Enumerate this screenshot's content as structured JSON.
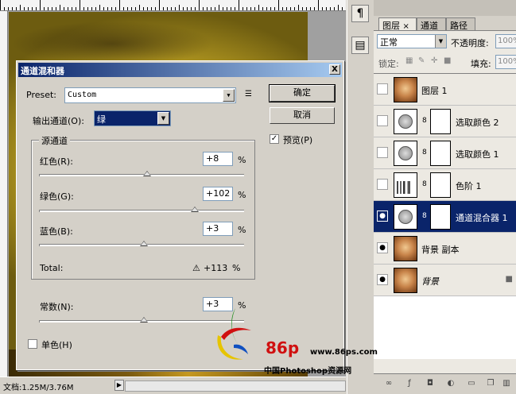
{
  "statusbar": {
    "doc_info": "文档:1.25M/3.76M",
    "arrow": "▶"
  },
  "tool_strip": {
    "pilcrow": "¶",
    "doc": "▤"
  },
  "layers_panel": {
    "tabs": [
      {
        "label": "图层",
        "close": "×"
      },
      {
        "label": "通道"
      },
      {
        "label": "路径"
      }
    ],
    "blend_mode": "正常",
    "opacity_label": "不透明度:",
    "opacity_value": "100%",
    "lock_label": "锁定:",
    "fill_label": "填充:",
    "fill_value": "100%",
    "layers": [
      {
        "name": "图层 1",
        "type": "photo",
        "visible": false
      },
      {
        "name": "选取颜色 2",
        "type": "selective-color",
        "visible": false
      },
      {
        "name": "选取颜色 1",
        "type": "selective-color",
        "visible": false
      },
      {
        "name": "色阶 1",
        "type": "levels",
        "visible": false
      },
      {
        "name": "通道混合器 1",
        "type": "channel-mixer",
        "visible": true,
        "selected": true
      },
      {
        "name": "背景 副本",
        "type": "photo",
        "visible": true
      },
      {
        "name": "背景",
        "type": "photo",
        "visible": true,
        "locked": true
      }
    ]
  },
  "dialog": {
    "title": "通道混和器",
    "close": "X",
    "preset_label": "Preset:",
    "preset_value": "Custom",
    "output_label": "输出通道(O):",
    "output_value": "绿",
    "ok_label": "确定",
    "cancel_label": "取消",
    "preview_label": "预览(P)",
    "preview_checked": true,
    "source_group_label": "源通道",
    "red_label": "红色(R):",
    "red_value": "+8",
    "green_label": "绿色(G):",
    "green_value": "+102",
    "blue_label": "蓝色(B):",
    "blue_value": "+3",
    "percent": "%",
    "total_label": "Total:",
    "total_value": "+113",
    "warning": "⚠",
    "constant_label": "常数(N):",
    "constant_value": "+3",
    "monochrome_label": "单色(H)",
    "monochrome_checked": false
  },
  "watermark": {
    "brand": "86p",
    "url": "www.86ps.com",
    "site_name": "中国Photoshop资源网"
  }
}
